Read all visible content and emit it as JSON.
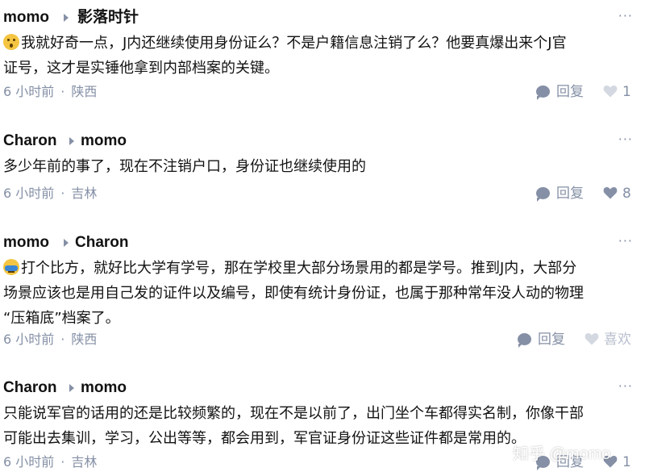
{
  "comments": [
    {
      "author": "momo",
      "reply_to": "影落时针",
      "emoji": "surprised",
      "lines": [
        "我就好奇一点，J内还继续使用身份证么？不是户籍信息注销了么？他要真爆出来个J官",
        "证号，这才是实锤他拿到内部档案的关键。"
      ],
      "time": "6 小时前",
      "location": "陕西",
      "reply_label": "回复",
      "like_label": "1"
    },
    {
      "author": "Charon",
      "reply_to": "momo",
      "emoji": "",
      "lines": [
        "多少年前的事了，现在不注销户口，身份证也继续使用的"
      ],
      "time": "6 小时前",
      "location": "吉林",
      "reply_label": "回复",
      "like_label": "8"
    },
    {
      "author": "momo",
      "reply_to": "Charon",
      "emoji": "facepalm",
      "lines": [
        "打个比方，就好比大学有学号，那在学校里大部分场景用的都是学号。推到J内，大部分",
        "场景应该也是用自己发的证件以及编号，即使有统计身份证，也属于那种常年没人动的物理",
        "“压箱底”档案了。"
      ],
      "time": "6 小时前",
      "location": "陕西",
      "reply_label": "回复",
      "like_label": "喜欢"
    },
    {
      "author": "Charon",
      "reply_to": "momo",
      "emoji": "",
      "lines": [
        "只能说军官的话用的还是比较频繁的，现在不是以前了，出门坐个车都得实名制，你像干部",
        "可能出去集训，学习，公出等等，都会用到，军官证身份证这些证件都是常用的。"
      ],
      "time": "6 小时前",
      "location": "吉林",
      "reply_label": "回复",
      "like_label": "1"
    }
  ],
  "more_icon": "···",
  "separator": "·",
  "watermark": "知乎 @momo"
}
